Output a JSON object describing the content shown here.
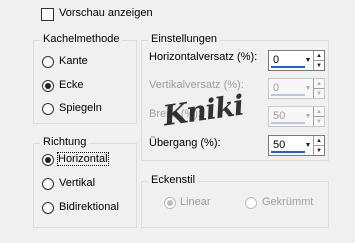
{
  "preview": {
    "label": "Vorschau anzeigen",
    "checked": false
  },
  "kachelmethode": {
    "title": "Kachelmethode",
    "options": [
      {
        "label": "Kante",
        "selected": false
      },
      {
        "label": "Ecke",
        "selected": true
      },
      {
        "label": "Spiegeln",
        "selected": false
      }
    ]
  },
  "richtung": {
    "title": "Richtung",
    "options": [
      {
        "label": "Horizontal",
        "selected": true
      },
      {
        "label": "Vertikal",
        "selected": false
      },
      {
        "label": "Bidirektional",
        "selected": false
      }
    ]
  },
  "einstellungen": {
    "title": "Einstellungen",
    "fields": [
      {
        "label": "Horizontalversatz (%):",
        "value": "0",
        "enabled": true
      },
      {
        "label": "Vertikalversatz (%):",
        "value": "0",
        "enabled": false
      },
      {
        "label": "Breite (%):",
        "value": "50",
        "enabled": false
      },
      {
        "label": "Übergang (%):",
        "value": "50",
        "enabled": true
      }
    ]
  },
  "eckenstil": {
    "title": "Eckenstil",
    "options": [
      {
        "label": "Linear",
        "selected": true,
        "enabled": false
      },
      {
        "label": "Gekrümmt",
        "selected": false,
        "enabled": false
      }
    ]
  },
  "watermark": "Kniki"
}
